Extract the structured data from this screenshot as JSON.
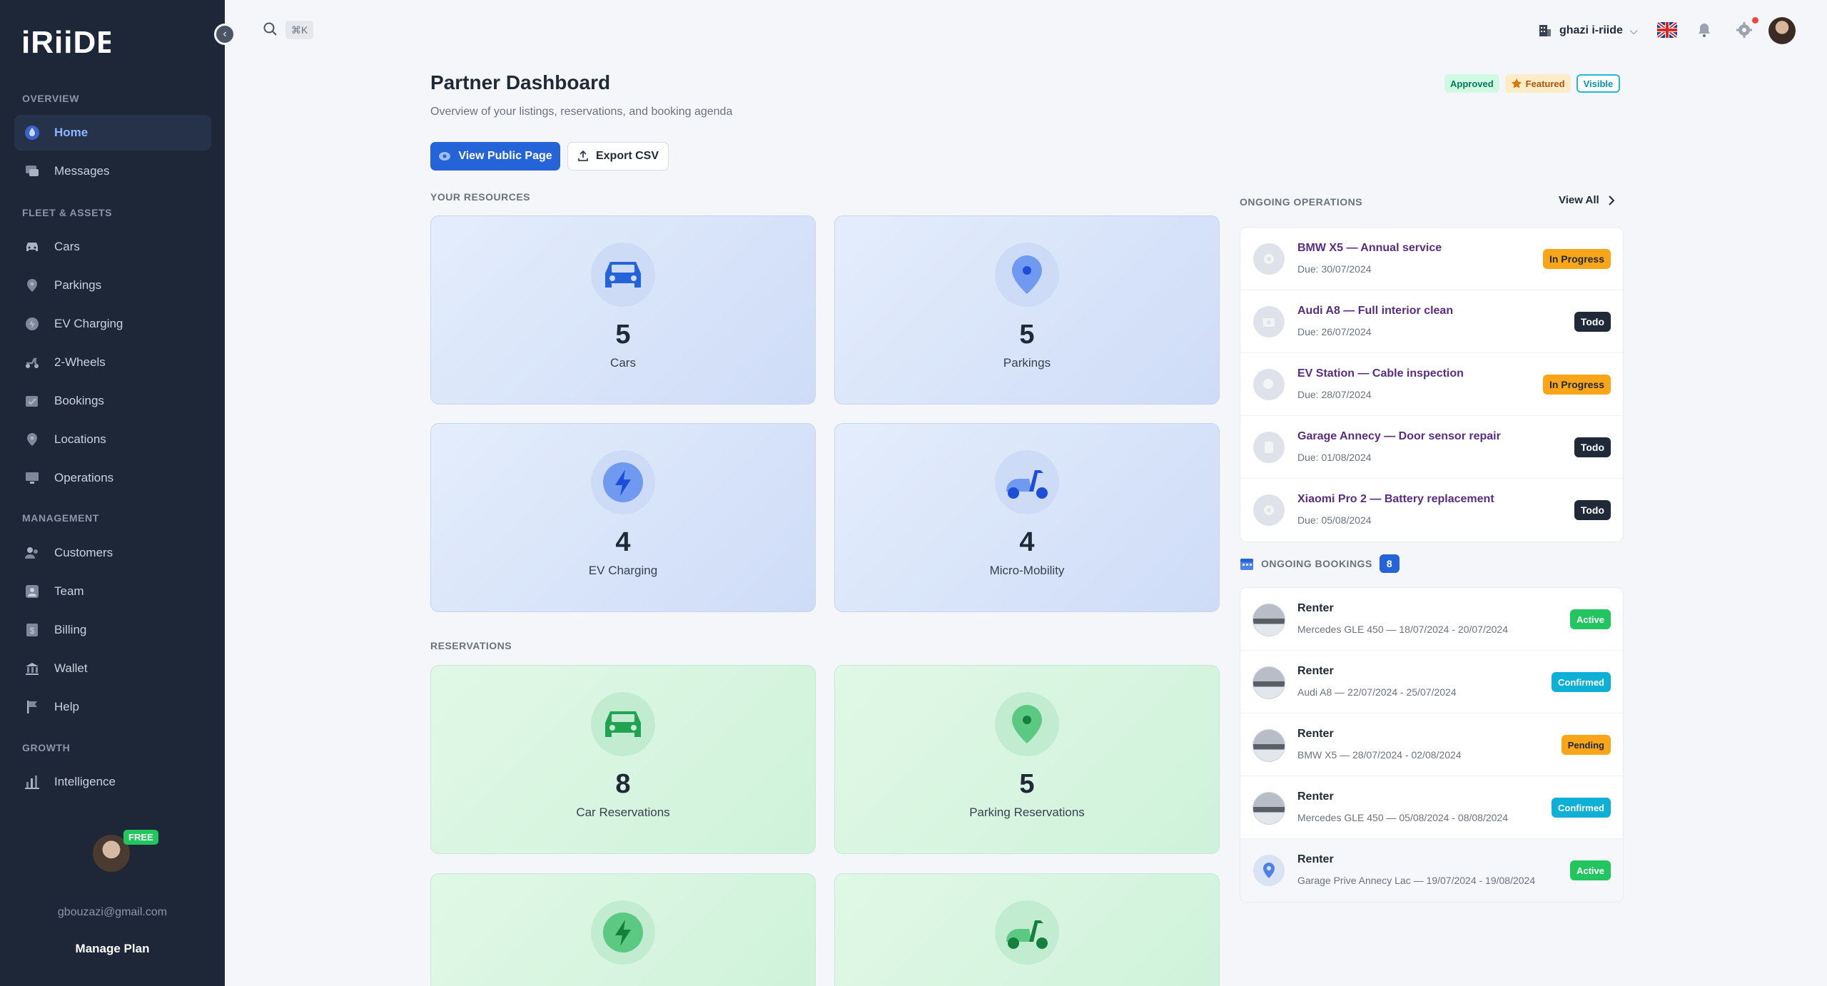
{
  "sidebar": {
    "logo_text": "iRiiDE",
    "sections": {
      "overview": "OVERVIEW",
      "fleet": "FLEET & ASSETS",
      "management": "MANAGEMENT",
      "growth": "GROWTH"
    },
    "items": {
      "home": "Home",
      "messages": "Messages",
      "cars": "Cars",
      "parkings": "Parkings",
      "ev_charging": "EV Charging",
      "two_wheels": "2-Wheels",
      "bookings": "Bookings",
      "locations": "Locations",
      "operations": "Operations",
      "customers": "Customers",
      "team": "Team",
      "billing": "Billing",
      "wallet": "Wallet",
      "help": "Help",
      "intelligence": "Intelligence"
    },
    "plan_badge": "FREE",
    "email": "gbouzazi@gmail.com",
    "manage_plan": "Manage Plan"
  },
  "topbar": {
    "shortcut": "⌘K",
    "org_name": "ghazi i-riide"
  },
  "header": {
    "title": "Partner Dashboard",
    "subtitle": "Overview of your listings, reservations, and booking agenda",
    "badges": {
      "approved": "Approved",
      "featured": "Featured",
      "visible": "Visible"
    },
    "view_public": "View Public Page",
    "export_csv": "Export CSV"
  },
  "resources": {
    "label": "YOUR RESOURCES",
    "cards": [
      {
        "value": "5",
        "label": "Cars"
      },
      {
        "value": "5",
        "label": "Parkings"
      },
      {
        "value": "4",
        "label": "EV Charging"
      },
      {
        "value": "4",
        "label": "Micro-Mobility"
      }
    ]
  },
  "reservations": {
    "label": "RESERVATIONS",
    "cards": [
      {
        "value": "8",
        "label": "Car Reservations"
      },
      {
        "value": "5",
        "label": "Parking Reservations"
      }
    ]
  },
  "operations": {
    "label": "ONGOING OPERATIONS",
    "view_all": "View All",
    "items": [
      {
        "title": "BMW X5 — Annual service",
        "due": "Due: 30/07/2024",
        "status": "In Progress"
      },
      {
        "title": "Audi A8 — Full interior clean",
        "due": "Due: 26/07/2024",
        "status": "Todo"
      },
      {
        "title": "EV Station — Cable inspection",
        "due": "Due: 28/07/2024",
        "status": "In Progress"
      },
      {
        "title": "Garage Annecy — Door sensor repair",
        "due": "Due: 01/08/2024",
        "status": "Todo"
      },
      {
        "title": "Xiaomi Pro 2 — Battery replacement",
        "due": "Due: 05/08/2024",
        "status": "Todo"
      }
    ]
  },
  "bookings": {
    "label": "ONGOING BOOKINGS",
    "count": "8",
    "items": [
      {
        "renter": "Renter",
        "detail": "Mercedes GLE 450 — 18/07/2024 - 20/07/2024",
        "status": "Active"
      },
      {
        "renter": "Renter",
        "detail": "Audi A8 — 22/07/2024 - 25/07/2024",
        "status": "Confirmed"
      },
      {
        "renter": "Renter",
        "detail": "BMW X5 — 28/07/2024 - 02/08/2024",
        "status": "Pending"
      },
      {
        "renter": "Renter",
        "detail": "Mercedes GLE 450 — 05/08/2024 - 08/08/2024",
        "status": "Confirmed"
      },
      {
        "renter": "Renter",
        "detail": "Garage Prive Annecy Lac — 19/07/2024 - 19/08/2024",
        "status": "Active"
      }
    ]
  },
  "colors": {
    "sidebar_bg": "#1d2738",
    "primary": "#2563d9",
    "in_progress": "#f9a51a",
    "active": "#22c55e",
    "confirmed": "#0fb0d6"
  }
}
